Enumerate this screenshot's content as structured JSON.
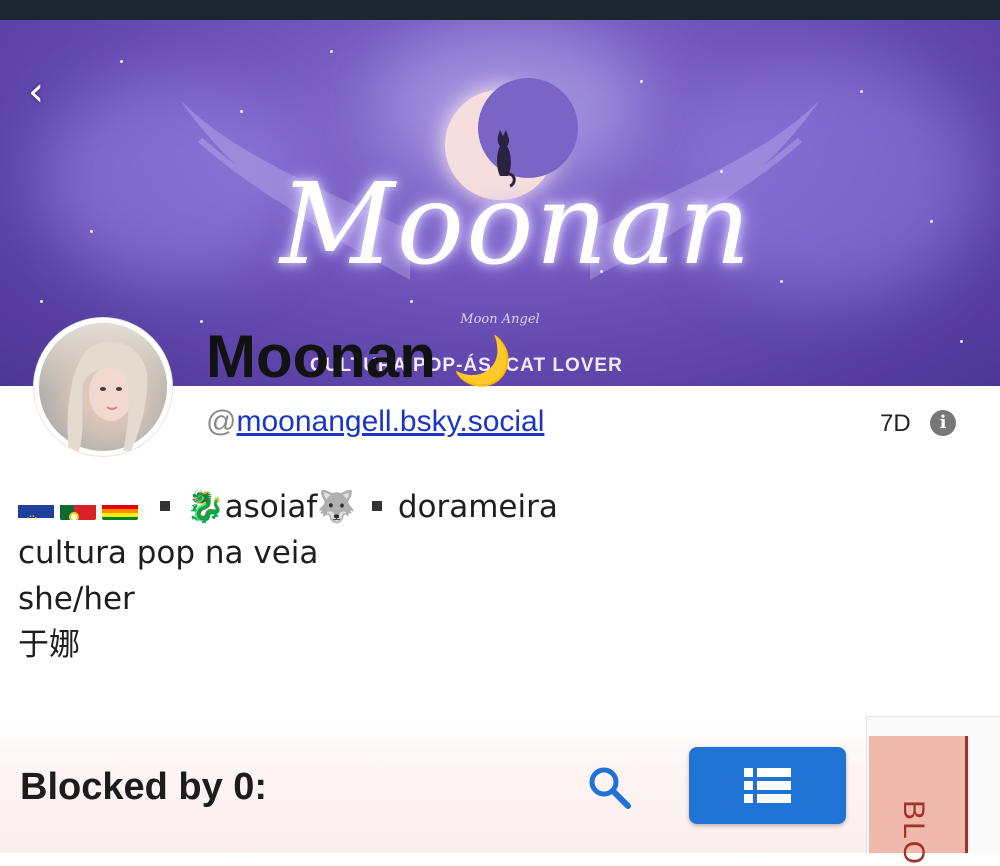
{
  "banner": {
    "title": "Moonan",
    "subtitle": "Moon Angel",
    "tagline": "CULTURA POP-ÁS  -CAT LOVER"
  },
  "nav": {
    "back_icon": "chevron-left-icon",
    "back_label": "‹"
  },
  "profile": {
    "display_name": "Moonan",
    "display_name_emoji": "🌙",
    "handle_prefix": "@",
    "handle": "moonangell.bsky.social",
    "age": "7D",
    "info_icon": "info-icon",
    "info_glyph": "i"
  },
  "bio": {
    "line1_flags": [
      "cape-verde-flag",
      "portugal-flag",
      "rainbow-flag"
    ],
    "line1_part2": "🐉asoiaf🐺",
    "line1_part3": "dorameira",
    "line2": "cultura pop na veia",
    "line3": "she/her",
    "line4": "于娜"
  },
  "blocked": {
    "label": "Blocked by 0:",
    "search_icon": "search-icon",
    "list_icon": "list-icon"
  },
  "side_panel": {
    "label": "BLO"
  },
  "colors": {
    "accent_blue": "#1f73d4",
    "link_blue": "#1a35c8",
    "banner_purple": "#6f56bb",
    "side_tab": "#f1b8ac",
    "side_text": "#a0322a"
  }
}
